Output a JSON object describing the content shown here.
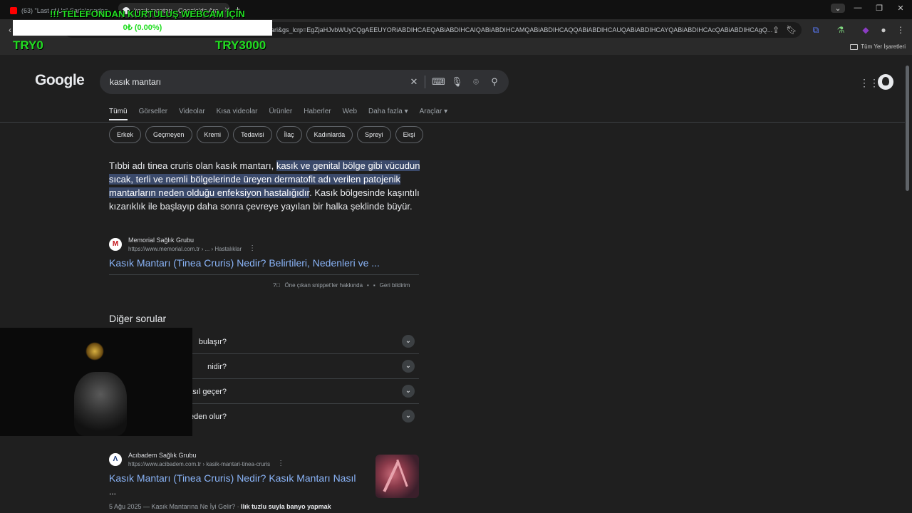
{
  "browser": {
    "tabs": [
      {
        "title": "(63) \"Last of Us\" Şarkılarından",
        "fav_color": "#ff0000"
      },
      {
        "title": "kasık mantarı - Google'da Ara",
        "fav_color": "#e8eaed"
      }
    ],
    "new_tab": "+",
    "url": "ari&gs_lcrp=EgZjaHJvbWUyCQgAEEUYORiABDIHCAEQABiABDIHCAIQABiABDIHCAMQABiABDIHCAQQABiABDIHCAUQABiABDIHCAYQABiABDIHCAcQABiABDIHCAgQ...",
    "bookmarks_all": "Tüm Yer İşaretleri"
  },
  "overlay": {
    "banner": "!!! TELEFONDAN KURTULUŞ WEBCAM İÇİN",
    "progress_text": "0₺ (0.00%)",
    "progress": 0,
    "left_label": "TRY0",
    "right_label": "TRY3000"
  },
  "google": {
    "logo": "Google",
    "query": "kasık mantarı",
    "tabs": [
      "Tümü",
      "Görseller",
      "Videolar",
      "Kısa videolar",
      "Ürünler",
      "Haberler",
      "Web",
      "Daha fazla ▾",
      "Araçlar ▾"
    ],
    "chips": [
      "Erkek",
      "Geçmeyen",
      "Kremi",
      "Tedavisi",
      "İlaç",
      "Kadınlarda",
      "Spreyi",
      "Ekşi"
    ],
    "snippet": {
      "pre": "Tıbbi adı tinea cruris olan kasık mantarı, ",
      "highlight": "kasık ve genital bölge gibi vücudun sıcak, terli ve nemli bölgelerinde üreyen dermatofit adı verilen patojenik mantarların neden olduğu enfeksiyon hastalığıdır",
      "post": ". Kasık bölgesinde kaşıntılı kızarıklık ile başlayıp daha sonra çevreye yayılan bir halka şeklinde büyür."
    },
    "result1": {
      "logo_letter": "M",
      "source": "Memorial Sağlık Grubu",
      "url": "https://www.memorial.com.tr › ... › Hastalıklar",
      "title": "Kasık Mantarı (Tinea Cruris) Nedir? Belirtileri, Nedenleri ve ..."
    },
    "about_snippets": "Öne çıkan snippet'ler hakkında",
    "dot": "•",
    "feedback": "Geri bildirim",
    "paa_title": "Diğer sorular",
    "paa": [
      "bulaşır?",
      "nidir?",
      "fksiyonu nasıl geçer?",
      "neden olur?"
    ],
    "result2": {
      "logo_letter": "Λ",
      "source": "Acıbadem Sağlık Grubu",
      "url": "https://www.acibadem.com.tr › kasik-mantari-tinea-cruris",
      "title": "Kasık Mantarı (Tinea Cruris) Nedir? Kasık Mantarı Nasıl",
      "title2": "...",
      "meta": "5 Ağu 2025 — Kasık Mantarına Ne İyi Gelir? · ",
      "meta_bold": "Ilık tuzlu suyla banyo yapmak"
    }
  }
}
